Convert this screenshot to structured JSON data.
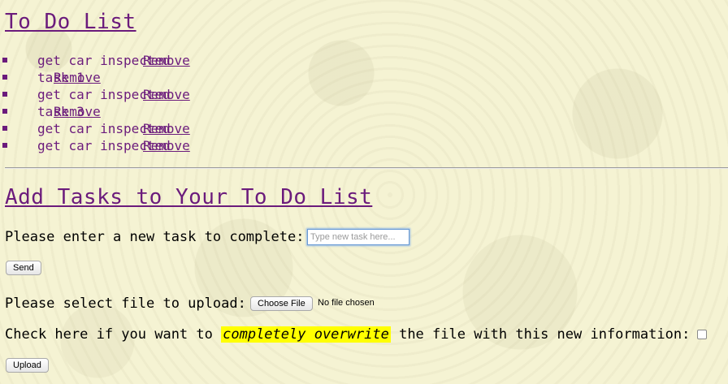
{
  "heading": "To Do List",
  "tasks": [
    {
      "text": "get car inspected",
      "remove": "Remove"
    },
    {
      "text": "task 1",
      "remove": "Remove"
    },
    {
      "text": "get car inspected",
      "remove": "Remove"
    },
    {
      "text": "task 3",
      "remove": "Remove"
    },
    {
      "text": "get car inspected",
      "remove": "Remove"
    },
    {
      "text": "get car inspected",
      "remove": "Remove"
    }
  ],
  "add_heading": "Add Tasks to Your To Do List",
  "task_form": {
    "label": "Please enter a new task to complete:",
    "placeholder": "Type new task here...",
    "send_label": "Send"
  },
  "file_form": {
    "label": "Please select file to upload:",
    "choose_label": "Choose File",
    "no_file_text": "No file chosen",
    "overwrite_prefix": "Check here if you want to",
    "overwrite_emphasis": "completely overwrite",
    "overwrite_suffix": "the file with this new information:",
    "upload_label": "Upload"
  },
  "colors": {
    "heading": "#6b1b7c",
    "background": "#f5f3d3",
    "highlight": "#ffff00"
  }
}
